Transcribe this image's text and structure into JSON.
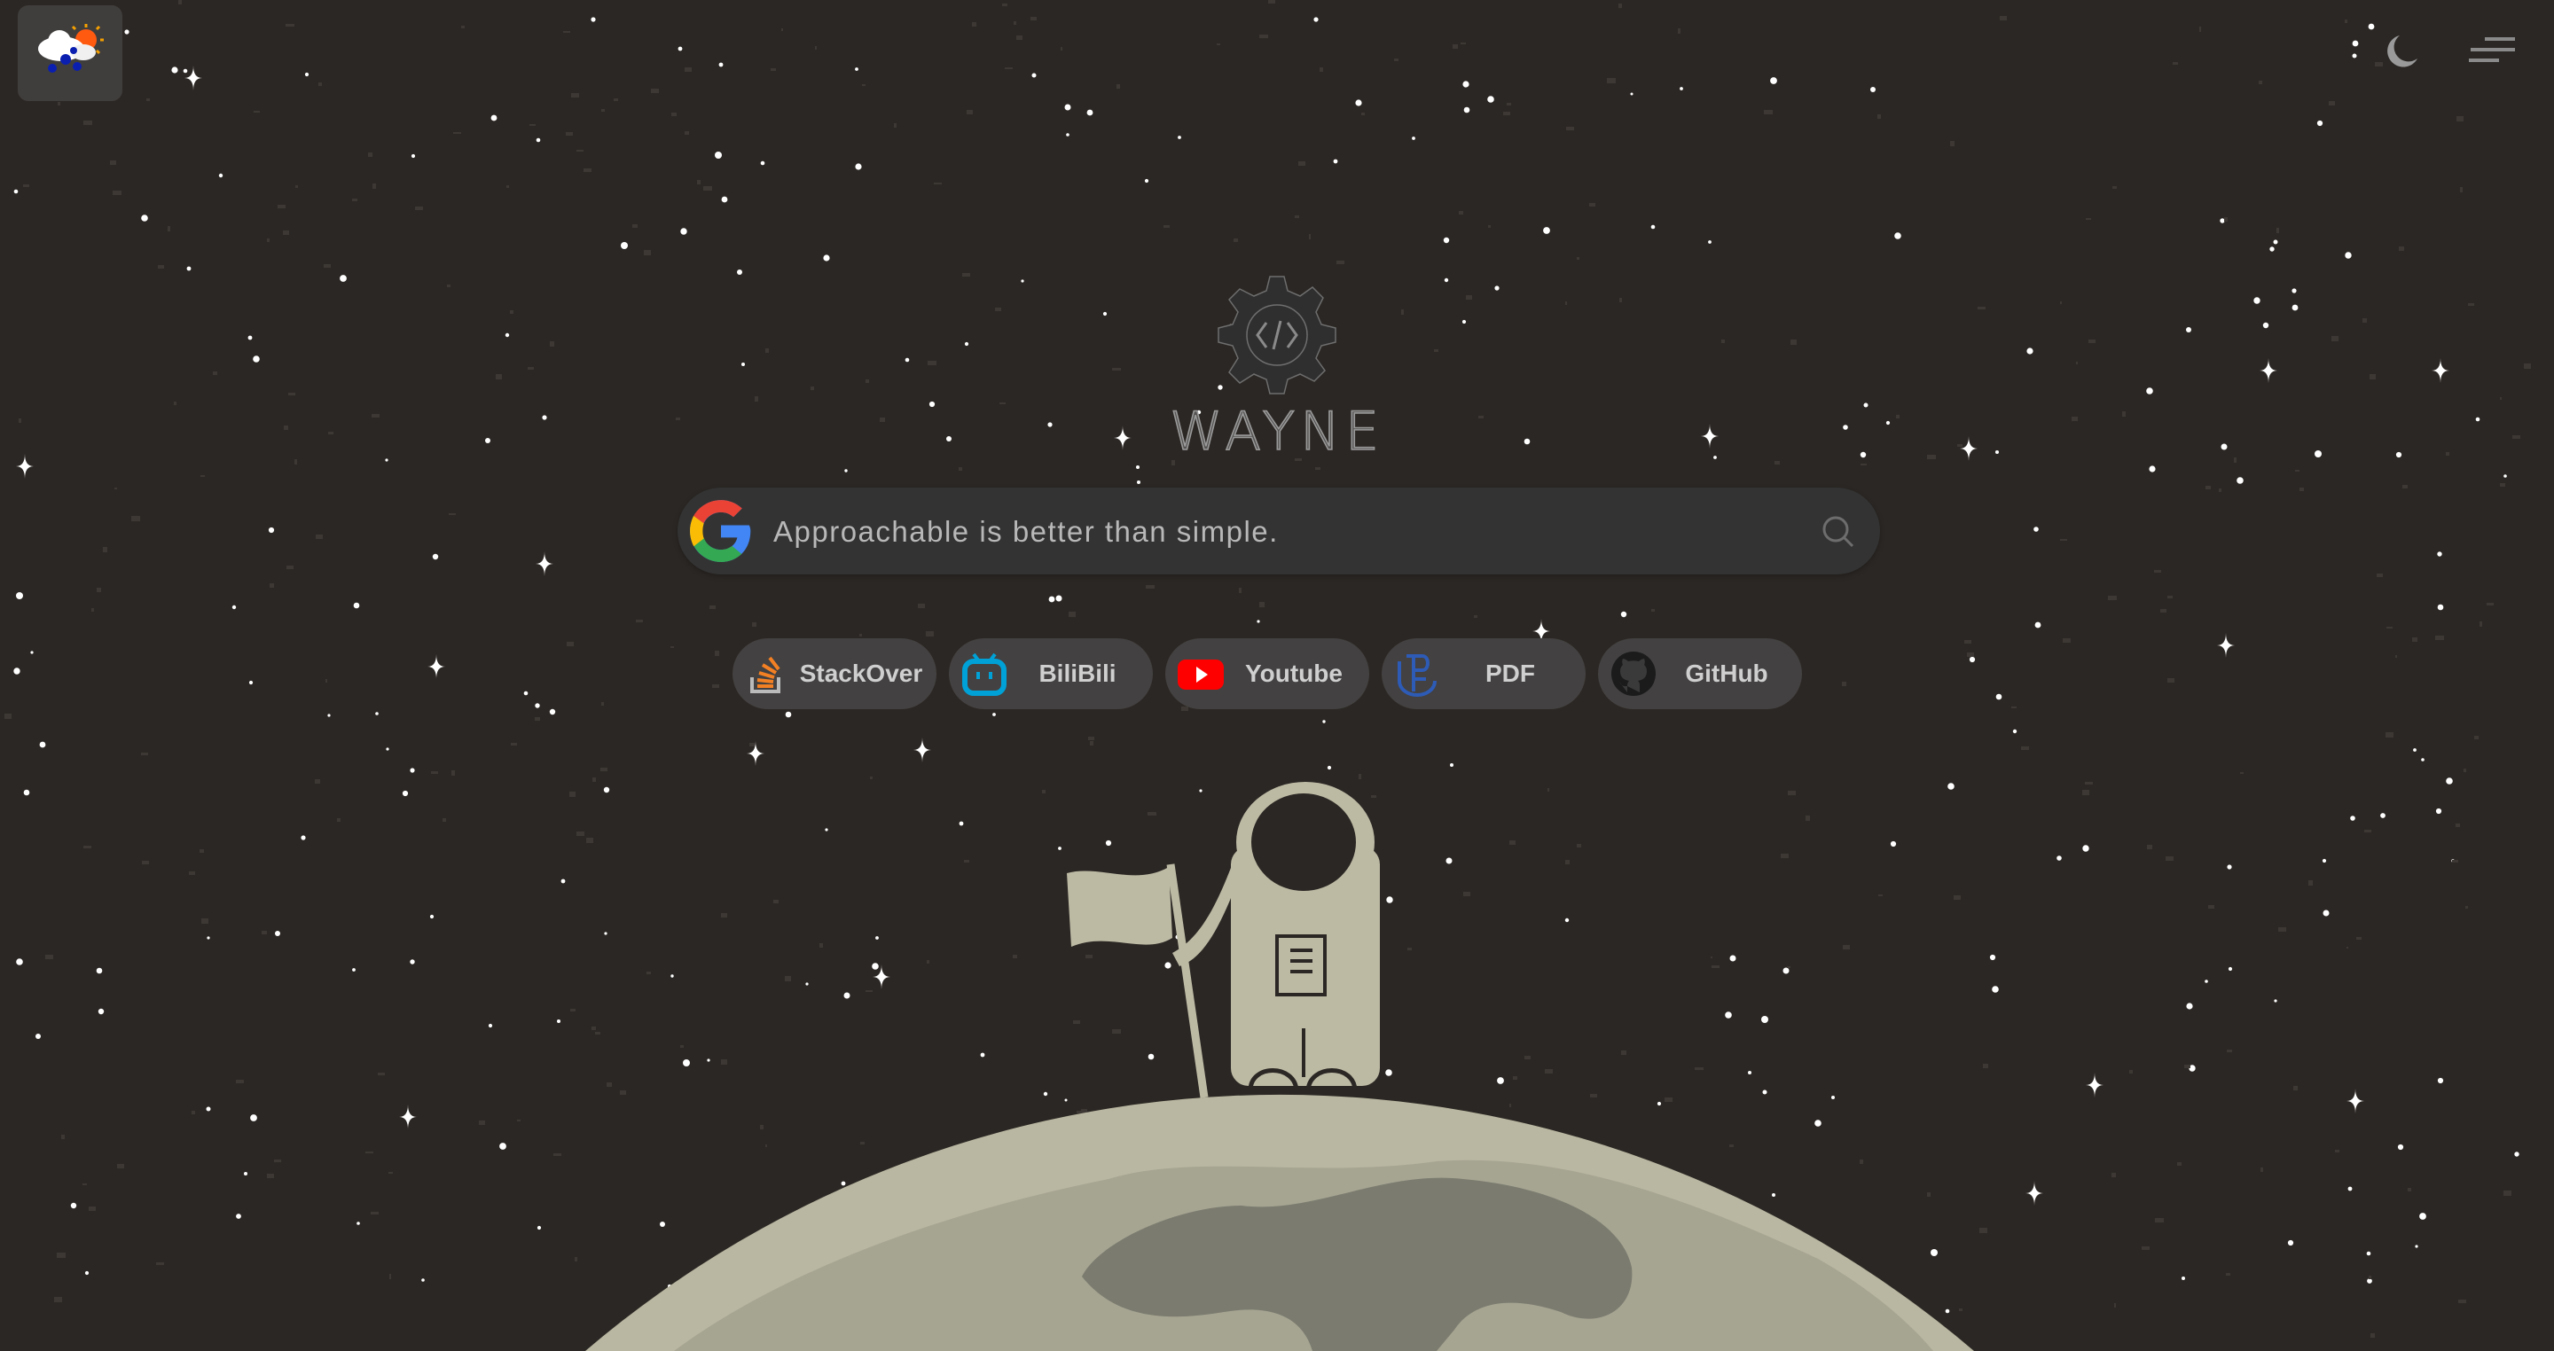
{
  "header": {
    "weather_icon": "rain-sun-weather-icon",
    "theme_toggle_icon": "moon-icon",
    "menu_icon": "hamburger-menu-icon"
  },
  "brand": {
    "logo_icon": "gear-code-icon",
    "name": "WAYNE"
  },
  "search": {
    "engine_icon": "google-icon",
    "value": "Approachable is better than simple.",
    "search_icon": "magnifier-icon"
  },
  "quick_links": [
    {
      "label": "StackOver",
      "icon": "stackoverflow-icon"
    },
    {
      "label": "BiliBili",
      "icon": "bilibili-icon"
    },
    {
      "label": "Youtube",
      "icon": "youtube-icon"
    },
    {
      "label": "PDF",
      "icon": "pdf-icon"
    },
    {
      "label": "GitHub",
      "icon": "github-icon"
    }
  ],
  "colors": {
    "background": "#2b2724",
    "moon_surface": "#b9b7a1",
    "astronaut": "#bdbaa4",
    "search_bar": "#333333",
    "link_button": "#434141"
  }
}
